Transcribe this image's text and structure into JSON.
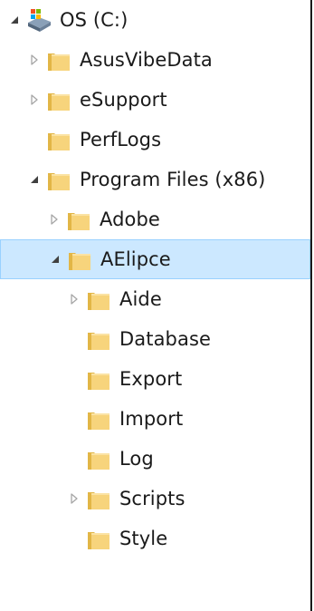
{
  "tree": {
    "items": [
      {
        "label": "OS (C:)",
        "level": 0,
        "expander": "expanded",
        "icon": "drive-icon"
      },
      {
        "label": "AsusVibeData",
        "level": 1,
        "expander": "collapsed",
        "icon": "folder-icon"
      },
      {
        "label": "eSupport",
        "level": 1,
        "expander": "collapsed",
        "icon": "folder-icon"
      },
      {
        "label": "PerfLogs",
        "level": 1,
        "expander": "none",
        "icon": "folder-icon"
      },
      {
        "label": "Program Files (x86)",
        "level": 1,
        "expander": "expanded",
        "icon": "folder-icon"
      },
      {
        "label": "Adobe",
        "level": 2,
        "expander": "collapsed",
        "icon": "folder-icon"
      },
      {
        "label": "AElipce",
        "level": 2,
        "expander": "expanded",
        "icon": "folder-icon",
        "selected": true
      },
      {
        "label": "Aide",
        "level": 3,
        "expander": "collapsed",
        "icon": "folder-icon"
      },
      {
        "label": "Database",
        "level": 3,
        "expander": "none",
        "icon": "folder-icon"
      },
      {
        "label": "Export",
        "level": 3,
        "expander": "none",
        "icon": "folder-icon"
      },
      {
        "label": "Import",
        "level": 3,
        "expander": "none",
        "icon": "folder-icon"
      },
      {
        "label": "Log",
        "level": 3,
        "expander": "none",
        "icon": "folder-icon"
      },
      {
        "label": "Scripts",
        "level": 3,
        "expander": "collapsed",
        "icon": "folder-icon"
      },
      {
        "label": "Style",
        "level": 3,
        "expander": "none",
        "icon": "folder-icon"
      }
    ]
  },
  "colors": {
    "selection_bg": "#cce8ff",
    "selection_border": "#99d1ff",
    "folder_body": "#f7d47c",
    "folder_dark": "#e2b646",
    "expander_collapsed": "#a6a6a6",
    "expander_expanded": "#404040"
  }
}
